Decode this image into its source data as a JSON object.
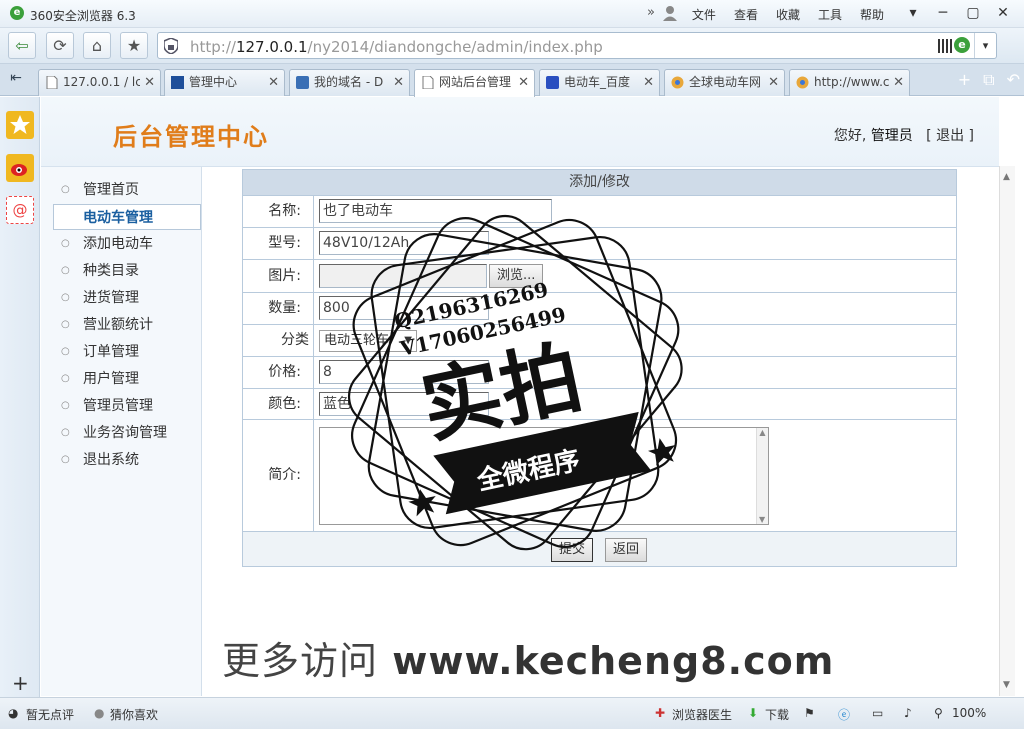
{
  "window": {
    "title": "360安全浏览器 6.3",
    "menu": [
      "文件",
      "查看",
      "收藏",
      "工具",
      "帮助"
    ],
    "controls": [
      "▾",
      "─",
      "▢",
      "✕"
    ]
  },
  "nav": {
    "url_prefix": "http://",
    "url_host": "127.0.0.1",
    "url_path": "/ny2014/diandongche/admin/index.php"
  },
  "tabs": [
    {
      "label": "127.0.0.1 / lc",
      "icon": "page-icon"
    },
    {
      "label": "管理中心",
      "icon": "site-icon"
    },
    {
      "label": "我的域名 - D",
      "icon": "domain-icon"
    },
    {
      "label": "网站后台管理",
      "icon": "page-icon"
    },
    {
      "label": "电动车_百度",
      "icon": "baidu-icon"
    },
    {
      "label": "全球电动车网",
      "icon": "chrome-icon"
    },
    {
      "label": "http://www.c",
      "icon": "chrome-icon"
    }
  ],
  "header": {
    "title": "后台管理中心",
    "greeting": "您好,",
    "user": "管理员",
    "logout": "[ 退出 ]"
  },
  "sidebar": {
    "items": [
      {
        "label": "管理首页"
      },
      {
        "label": "电动车管理",
        "active": true
      },
      {
        "label": "添加电动车"
      },
      {
        "label": "种类目录"
      },
      {
        "label": "进货管理"
      },
      {
        "label": "营业额统计"
      },
      {
        "label": "订单管理"
      },
      {
        "label": "用户管理"
      },
      {
        "label": "管理员管理"
      },
      {
        "label": "业务咨询管理"
      },
      {
        "label": "退出系统"
      }
    ]
  },
  "form": {
    "title": "添加/修改",
    "fields": {
      "name_label": "名称:",
      "name_value": "也了电动车",
      "model_label": "型号:",
      "model_value": "48V10/12Ah",
      "image_label": "图片:",
      "browse_label": "浏览...",
      "qty_label": "数量:",
      "qty_value": "800",
      "category_label": "分类",
      "category_value": "电动三轮车",
      "price_label": "价格:",
      "price_value": "8",
      "color_label": "颜色:",
      "color_value": "蓝色",
      "intro_label": "简介:"
    },
    "submit_label": "提交",
    "back_label": "返回"
  },
  "stamp": {
    "line1": "Q2196316269",
    "line2": "V17060256499",
    "main": "实拍",
    "banner": "全微程序"
  },
  "watermark": {
    "lead": "更多访问",
    "site": "www.kecheng8.com"
  },
  "status": {
    "left1": "暂无点评",
    "left2": "猜你喜欢",
    "doctor": "浏览器医生",
    "download": "下载",
    "zoom": "100%"
  },
  "colors": {
    "header_title": "#e07d1a",
    "active_nav": "#1a5fa0",
    "form_head": "#cfdbe8"
  }
}
